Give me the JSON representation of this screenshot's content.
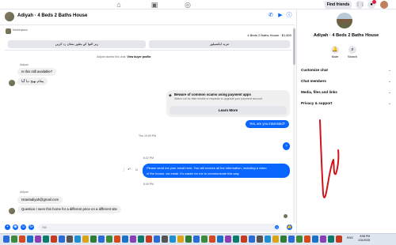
{
  "topbar": {
    "find_friends": "Find friends"
  },
  "chat": {
    "title": "Adiyah · 4 Beds 2 Baths House",
    "listing": {
      "marketplace_label": "Marketplace",
      "title": "4 Beds 2 Baths House · $1,600",
      "button_right": "مزید ایکسپلور",
      "button_left": "زیر التوا کے بطور نشان زد کریں"
    },
    "system_note_prefix": "Adiyah started this chat.",
    "system_note_link": "View buyer profile",
    "sender_name_1": "Adiyah",
    "msg_1": "Is this still available?",
    "msg_2": "پیغام بھیج دیا گیا",
    "scam_title": "Beware of common scams using payment apps",
    "scam_desc": "Watch out for fake emails or requests to upgrade your payment account.",
    "learn_more": "Learn More",
    "out_msg_1": "Yes, are you interested?",
    "time_1": "Thu 10:59 PM",
    "out_small": "?",
    "time_2": "8:22 PM",
    "out_msg_2_line1": "Please send me your email here. You will receive all the information, including a video",
    "out_msg_2_line2": "of the house, via email. It's easier for me to communicate this way.",
    "time_3": "8:49 PM",
    "sender_name_2": "Adiyah",
    "msg_3": "Israeladiyah@gmail.com",
    "msg_4": "Question I seen this home for a different price on a different site",
    "input_placeholder": "Aa"
  },
  "panel": {
    "title": "Adiyah · 4 Beds 2 Baths House",
    "mute": "Mute",
    "search": "Search",
    "items": [
      {
        "label": "Customize chat"
      },
      {
        "label": "Chat members"
      },
      {
        "label": "Media, files and links"
      },
      {
        "label": "Privacy & support"
      }
    ]
  },
  "taskbar": {
    "lang": "ENG",
    "time": "8:58 PM",
    "date": "1/31/2025"
  },
  "colors": {
    "accent": "#0866ff",
    "scribble": "#d0141b"
  }
}
